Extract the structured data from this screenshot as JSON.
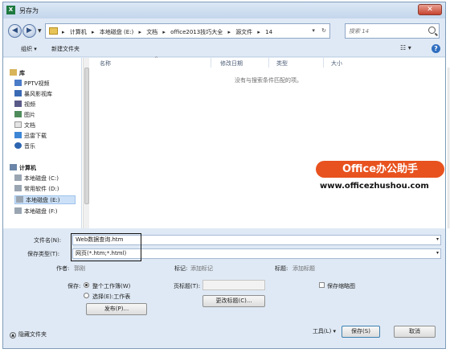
{
  "window": {
    "title": "另存为",
    "app_icon": "X",
    "close_glyph": "✕"
  },
  "nav": {
    "back_glyph": "◀",
    "forward_glyph": "▶",
    "history_glyph": "▼"
  },
  "address": {
    "crumbs": [
      "▸",
      "计算机",
      "▸",
      "本地磁盘 (E:)",
      "▸",
      "文档",
      "▸",
      "office2013技巧大全",
      "▸",
      "源文件",
      "▸",
      "14"
    ],
    "dropdown_glyph": "▾",
    "refresh_glyph": "↻"
  },
  "search": {
    "placeholder": "搜索 14"
  },
  "toolbar": {
    "organize": "组织 ▾",
    "new_folder": "新建文件夹",
    "view_glyph": "☷ ▾",
    "help_glyph": "?"
  },
  "sidebar": {
    "library_head": "库",
    "library_items": [
      "PPTV视频",
      "暴风影视库",
      "视频",
      "图片",
      "文档",
      "迅雷下载",
      "音乐"
    ],
    "computer_head": "计算机",
    "drives": [
      "本地磁盘 (C:)",
      "常用软件 (D:)",
      "本地磁盘 (E:)",
      "本地磁盘 (F:)"
    ]
  },
  "columns": {
    "name": "名称",
    "date": "修改日期",
    "type": "类型",
    "size": "大小",
    "sort_glyph": "^"
  },
  "empty_message": "没有与搜索条件匹配的项。",
  "form": {
    "filename_label": "文件名(N):",
    "filename_value": "Web数据查询.htm",
    "savetype_label": "保存类型(T):",
    "savetype_value": "网页(*.htm;*.html)",
    "author_label": "作者:",
    "author_value": "郭刚",
    "tags_label": "标记:",
    "tags_value": "添加标记",
    "title_label": "标题:",
    "title_value": "添加标题",
    "save_label": "保存:",
    "whole_workbook": "整个工作簿(W)",
    "selection": "选择(E):工作表",
    "page_title_label": "页标题(T):",
    "keep_thumbnail": "保存缩略图",
    "publish_button": "发布(P)...",
    "change_title_button": "更改标题(C)...",
    "tools_button": "工具(L)  ▾",
    "save_button": "保存(S)",
    "cancel_button": "取消"
  },
  "hide_folders": "隐藏文件夹",
  "watermark": {
    "badge": "Office办公助手",
    "url": "www.officezhushou.com"
  },
  "colors": {
    "accent": "#e8521f",
    "selection": "#cce1f7",
    "frame": "#dfe9f5"
  }
}
